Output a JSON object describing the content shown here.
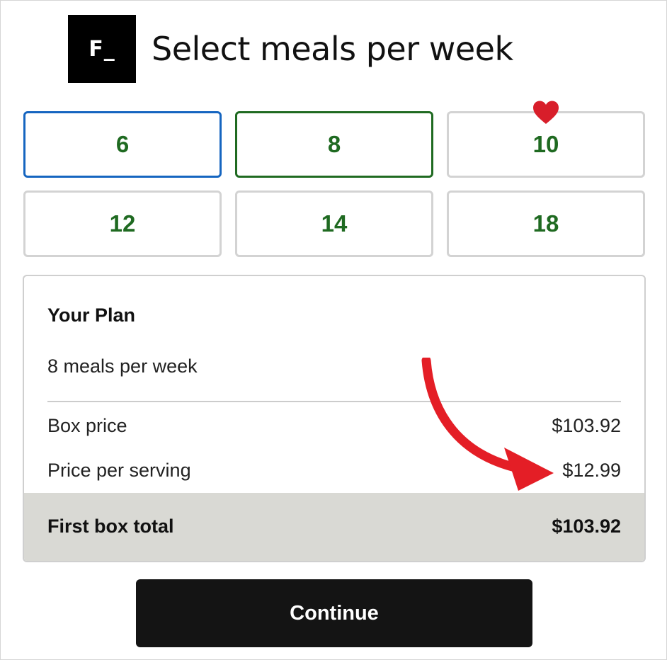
{
  "logo": {
    "text": "F_"
  },
  "header": {
    "title": "Select meals per week"
  },
  "meal_options": [
    {
      "label": "6",
      "state": "focused"
    },
    {
      "label": "8",
      "state": "selected"
    },
    {
      "label": "10",
      "state": "default",
      "badge_icon": "heart-icon"
    },
    {
      "label": "12",
      "state": "default"
    },
    {
      "label": "14",
      "state": "default"
    },
    {
      "label": "18",
      "state": "default"
    }
  ],
  "plan": {
    "heading": "Your Plan",
    "summary": "8 meals per week",
    "box_price_label": "Box price",
    "box_price_value": "$103.92",
    "price_per_serving_label": "Price per serving",
    "price_per_serving_value": "$12.99",
    "total_label": "First box total",
    "total_value": "$103.92"
  },
  "annotation": {
    "icon": "arrow-icon",
    "color": "#e41e26"
  },
  "continue_button": {
    "label": "Continue"
  },
  "colors": {
    "accent_green": "#1f6a21",
    "focus_blue": "#1565c0",
    "heart_red": "#d81e2a",
    "button_dark": "#141414",
    "total_bar": "#d9d9d4"
  }
}
